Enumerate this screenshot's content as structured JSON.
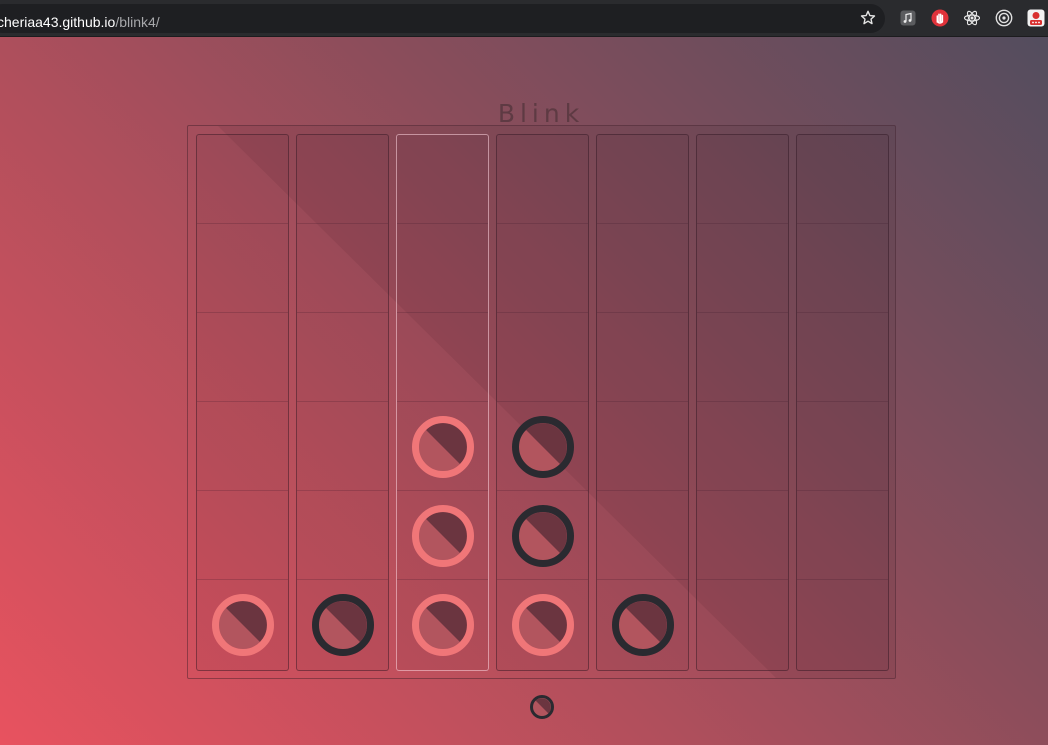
{
  "browser": {
    "url_host": "cheriaa43.github.io",
    "url_path": "/blink4/",
    "toolbar_icons": [
      "bookmark-star-icon",
      "music-extension-icon",
      "hand-extension-icon",
      "react-devtools-icon",
      "target-extension-icon",
      "profile-extension-icon"
    ]
  },
  "game": {
    "title": "Blink",
    "columns": 7,
    "rows": 6,
    "hover_column": 2,
    "colors": {
      "pink": "#f07678",
      "dark": "#2a2a30",
      "disc_center_light": "#b2555e",
      "disc_center_shade": "#6b3540"
    },
    "board": [
      [
        null,
        null,
        null,
        null,
        null,
        null,
        null
      ],
      [
        null,
        null,
        null,
        null,
        null,
        null,
        null
      ],
      [
        null,
        null,
        null,
        null,
        null,
        null,
        null
      ],
      [
        null,
        null,
        "pink",
        "dark",
        null,
        null,
        null
      ],
      [
        null,
        null,
        "pink",
        "dark",
        null,
        null,
        null
      ],
      [
        "pink",
        "dark",
        "pink",
        "pink",
        "dark",
        null,
        null
      ]
    ],
    "current_turn": "dark"
  }
}
